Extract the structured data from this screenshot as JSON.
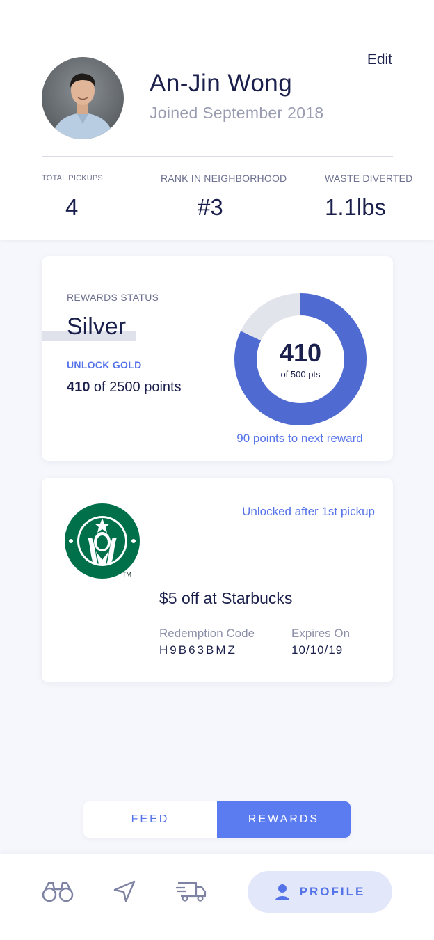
{
  "profile": {
    "edit_label": "Edit",
    "name": "An-Jin Wong",
    "joined": "Joined September 2018"
  },
  "stats": [
    {
      "label": "TOTAL PICKUPS",
      "value": "4"
    },
    {
      "label": "RANK IN NEIGHBORHOOD",
      "value": "#3"
    },
    {
      "label": "WASTE DIVERTED",
      "value": "1.1lbs"
    }
  ],
  "rewards_status": {
    "label": "REWARDS STATUS",
    "tier": "Silver",
    "unlock_label": "UNLOCK GOLD",
    "points_current": "410",
    "points_suffix": " of 2500 points",
    "donut_value": "410",
    "donut_sub": "of 500 pts",
    "donut_progress": 0.82,
    "next_reward": "90 points to next reward"
  },
  "reward": {
    "brand": "Starbucks",
    "unlocked_note": "Unlocked after 1st pickup",
    "offer": "$5 off at Starbucks",
    "code_label": "Redemption Code",
    "code": "H9B63BMZ",
    "expires_label": "Expires On",
    "expires": "10/10/19",
    "tm": "TM"
  },
  "toggle": {
    "feed": "FEED",
    "rewards": "REWARDS",
    "active": "rewards"
  },
  "nav": {
    "items": [
      "binoculars-icon",
      "navigation-arrow-icon",
      "delivery-truck-icon",
      "user-icon"
    ],
    "profile_label": "PROFILE"
  },
  "colors": {
    "accent": "#5b7bf0",
    "navy": "#1a1f4b",
    "donut_fill": "#4f6bd1",
    "donut_track": "#e1e4ea",
    "starbucks_green": "#00704a"
  }
}
